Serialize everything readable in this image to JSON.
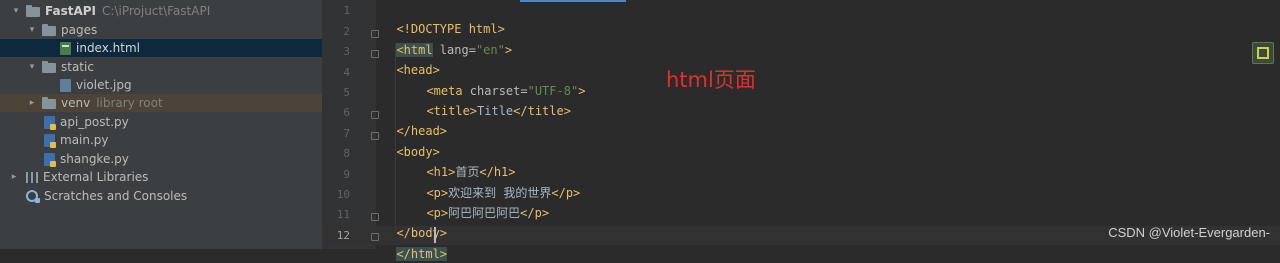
{
  "tree": {
    "root": {
      "name": "FastAPI",
      "path": "C:\\iProjuct\\FastAPI"
    },
    "pages_folder": "pages",
    "index_file": "index.html",
    "static_folder": "static",
    "violet_file": "violet.jpg",
    "venv_folder": "venv",
    "venv_note": "library root",
    "api_post_file": "api_post.py",
    "main_file": "main.py",
    "shangke_file": "shangke.py",
    "external_libraries": "External Libraries",
    "scratches": "Scratches and Consoles"
  },
  "editor": {
    "line_numbers": [
      "1",
      "2",
      "3",
      "4",
      "5",
      "6",
      "7",
      "8",
      "9",
      "10",
      "11",
      "12"
    ],
    "current_line": "12",
    "code": {
      "l1_doctype": "<!DOCTYPE html>",
      "l2_open": "<html",
      "l2_attr": " lang=",
      "l2_val": "\"en\"",
      "l2_close": ">",
      "l3": "<head>",
      "l4_open": "<meta",
      "l4_attr": " charset=",
      "l4_val": "\"UTF-8\"",
      "l4_close": ">",
      "l5_open": "<title>",
      "l5_text": "Title",
      "l5_close": "</title>",
      "l6": "</head>",
      "l7": "<body>",
      "l8_open": "<h1>",
      "l8_text": "首页",
      "l8_close": "</h1>",
      "l9_open": "<p>",
      "l9_text": "欢迎来到 我的世界",
      "l9_close": "</p>",
      "l10_open": "<p>",
      "l10_text": "阿巴阿巴阿巴",
      "l10_close": "</p>",
      "l11": "</body>",
      "l12": "</html>"
    }
  },
  "annotation": "html页面",
  "watermark": "CSDN @Violet-Evergarden-",
  "colors": {
    "tag": "#e8bf6a",
    "string": "#6a8759",
    "annotation": "#e0302b",
    "selection": "#0d293e"
  }
}
